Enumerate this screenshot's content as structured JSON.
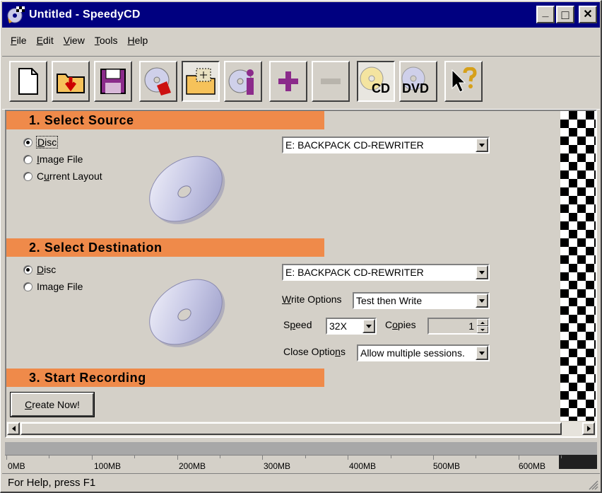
{
  "window": {
    "title": "Untitled - SpeedyCD",
    "minimize": "_",
    "maximize": "□",
    "close": "✕"
  },
  "menu": [
    {
      "pre": "",
      "key": "F",
      "post": "ile"
    },
    {
      "pre": "",
      "key": "E",
      "post": "dit"
    },
    {
      "pre": "",
      "key": "V",
      "post": "iew"
    },
    {
      "pre": "",
      "key": "T",
      "post": "ools"
    },
    {
      "pre": "",
      "key": "H",
      "post": "elp"
    }
  ],
  "toolbar": {
    "cd_label": "CD",
    "dvd_label": "DVD"
  },
  "source": {
    "header": "1. Select Source",
    "options": [
      {
        "pre": "",
        "key": "D",
        "post": "isc"
      },
      {
        "pre": "",
        "key": "I",
        "post": "mage File"
      },
      {
        "pre": "C",
        "key": "u",
        "post": "rrent Layout"
      }
    ],
    "drive": "E: BACKPACK CD-REWRITER"
  },
  "destination": {
    "header": "2. Select Destination",
    "options": [
      {
        "pre": "",
        "key": "D",
        "post": "isc"
      },
      {
        "pre": "Ima",
        "key": "g",
        "post": "e File"
      }
    ],
    "drive": "E: BACKPACK CD-REWRITER",
    "write_options_label": {
      "pre": "",
      "key": "W",
      "post": "rite Options"
    },
    "write_options_value": "Test then Write",
    "speed_label": {
      "pre": "S",
      "key": "p",
      "post": "eed"
    },
    "speed_value": "32X",
    "copies_label": {
      "pre": "C",
      "key": "o",
      "post": "pies"
    },
    "copies_value": "1",
    "close_options_label": {
      "pre": "Close Optio",
      "key": "n",
      "post": "s"
    },
    "close_options_value": "Allow multiple sessions."
  },
  "record": {
    "header": "3. Start Recording",
    "button": {
      "pre": "",
      "key": "C",
      "post": "reate Now!"
    }
  },
  "capacity": {
    "labels": [
      "0MB",
      "100MB",
      "200MB",
      "300MB",
      "400MB",
      "500MB",
      "600MB"
    ]
  },
  "status": {
    "text": "For Help, press F1"
  }
}
